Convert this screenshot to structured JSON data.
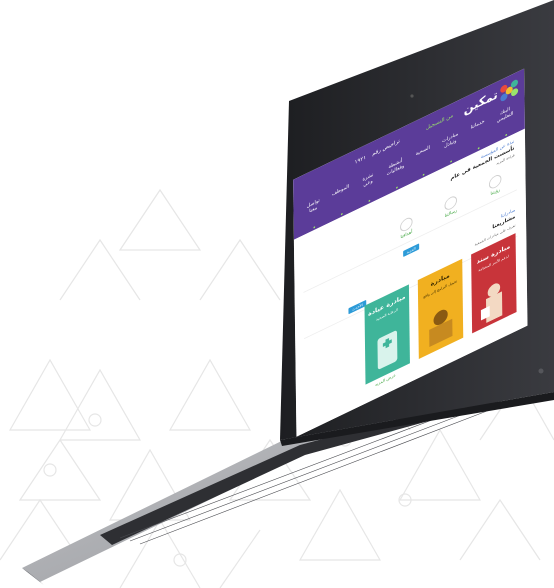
{
  "colors": {
    "header_purple": "#5b3c99",
    "accent_green": "#9be36b",
    "link_blue": "#4a7bd0",
    "pill_blue": "#2d9bd8",
    "card_red": "#c8343a",
    "card_yellow": "#f1b020",
    "card_teal": "#3fb59a",
    "laptop_body": "#2b2c30",
    "keyboard_deck": "#a7a9ad"
  },
  "site": {
    "logo_text": "تمكين",
    "top_links": [
      {
        "label": "من التسجيل",
        "active": true
      },
      {
        "label": "تراخيص رقم",
        "active": false
      },
      {
        "label": "١٩٢١",
        "active": false
      }
    ],
    "nav": [
      {
        "label": "البنك التعليمي"
      },
      {
        "label": "خدماتنا"
      },
      {
        "label": "مبادرات وتبادل"
      },
      {
        "label": "الصحية"
      },
      {
        "label": "أنشطة وفعاليات"
      },
      {
        "label": "نشرة وعي"
      },
      {
        "label": "الموظف"
      },
      {
        "label": "تواصل معنا"
      }
    ]
  },
  "content": {
    "section1": {
      "title": "نبذة عن المؤسسة",
      "subtitle": "تأسست الجمعية في عام",
      "small": "قراءة المزيد"
    },
    "features": [
      {
        "label": "رؤيتنا",
        "icon": "vision-icon"
      },
      {
        "label": "رسالتنا",
        "icon": "message-icon"
      },
      {
        "label": "أهدافنا",
        "icon": "goals-icon"
      }
    ],
    "section2": {
      "pill": "المزيد",
      "title": "مبادراتنا",
      "subtitle": "مشاريعنا",
      "small": "تعرف على مبادرات الجمعية"
    },
    "cards": [
      {
        "title": "مبادرة سند",
        "sub": "لدعم الأسر المحتاجة"
      },
      {
        "title": "مبادرة",
        "sub": "تحويل البرامج إلى واقع"
      },
      {
        "title": "مبادرة عيادة",
        "sub": "الرعاية الصحية"
      }
    ],
    "pill2": "الأحدث",
    "more_link": "عرض المزيد"
  }
}
